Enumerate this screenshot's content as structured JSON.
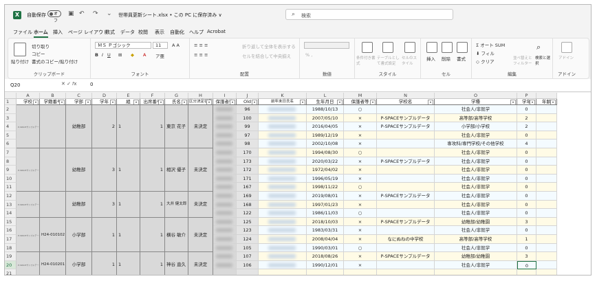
{
  "app": {
    "logo": "excel-logo",
    "autosave_label": "自動保存",
    "autosave_state": "オフ",
    "filename": "世帯員更新シート.xlsx • この PC に保存済み ∨",
    "search_placeholder": "検索"
  },
  "menu": {
    "tabs": [
      "ファイル",
      "ホーム",
      "挿入",
      "ページ レイアウト",
      "数式",
      "データ",
      "校閲",
      "表示",
      "自動化",
      "ヘルプ",
      "Acrobat"
    ],
    "active": "ホーム"
  },
  "ribbon": {
    "paste": "貼り付け",
    "cut": "切り取り",
    "copy": "コピー",
    "format_painter": "書式のコピー/貼り付け",
    "clipboard": "クリップボード",
    "font_name": "ＭＳ Ｐゴシック",
    "font_size": "11",
    "font_group": "フォント",
    "wrap_text": "折り返して全体を表示する",
    "merge_center": "セルを結合して中央揃え",
    "alignment_group": "配置",
    "number_group": "数値",
    "conditional_format": "条件付き書式",
    "format_as_table": "テーブルとして書式設定",
    "cell_styles": "セルのスタイル",
    "styles_group": "スタイル",
    "insert": "挿入",
    "delete": "削除",
    "format": "書式",
    "cells_group": "セル",
    "autosum": "オート SUM",
    "fill": "フィル",
    "clear": "クリア",
    "sort_filter": "並べ替えとフィルター",
    "find_select": "検索と選択",
    "editing_group": "編集",
    "addins": "アドイン",
    "addins_group": "アドイン"
  },
  "formula_bar": {
    "cell_ref": "Q20",
    "value": "0"
  },
  "columns": [
    "A",
    "B",
    "C",
    "D",
    "E",
    "F",
    "G",
    "H",
    "I",
    "J",
    "K",
    "L",
    "M",
    "N",
    "O",
    "P"
  ],
  "headers": [
    "学校",
    "学籍番号",
    "学部",
    "学年",
    "組",
    "出席番号",
    "氏名",
    "区分決定状況",
    "保護者等",
    "Old",
    "前年末日氏名",
    "生年月日",
    "保護者等",
    "学校名",
    "学種",
    "学年",
    "年齢"
  ],
  "rows": [
    {
      "n": "2",
      "old": "96",
      "birth": "1988/10/13",
      "m": "○",
      "school": "",
      "type": "社会人/非就学",
      "p": "0"
    },
    {
      "n": "3",
      "old": "100",
      "birth": "2007/05/10",
      "m": "×",
      "school": "P-SPACEサンプルデータ",
      "type": "高等部/高等学校",
      "p": "2"
    },
    {
      "n": "4",
      "old": "99",
      "birth": "2016/04/05",
      "m": "×",
      "school": "P-SPACEサンプルデータ",
      "type": "小学部/小学校",
      "p": "2"
    },
    {
      "n": "5",
      "old": "97",
      "birth": "1989/12/19",
      "m": "×",
      "school": "",
      "type": "社会人/非就学",
      "p": "0"
    },
    {
      "n": "6",
      "old": "98",
      "birth": "2002/10/08",
      "m": "×",
      "school": "",
      "type": "専攻科/専門学校/その他学校",
      "p": "4"
    },
    {
      "n": "7",
      "old": "170",
      "birth": "1994/08/30",
      "m": "○",
      "school": "",
      "type": "社会人/非就学",
      "p": "0"
    },
    {
      "n": "8",
      "old": "173",
      "birth": "2020/03/22",
      "m": "×",
      "school": "P-SPACEサンプルデータ",
      "type": "社会人/非就学",
      "p": "0"
    },
    {
      "n": "9",
      "old": "172",
      "birth": "1972/04/02",
      "m": "×",
      "school": "",
      "type": "社会人/非就学",
      "p": "0"
    },
    {
      "n": "10",
      "old": "171",
      "birth": "1996/05/19",
      "m": "×",
      "school": "",
      "type": "社会人/非就学",
      "p": "0"
    },
    {
      "n": "11",
      "old": "167",
      "birth": "1998/11/22",
      "m": "○",
      "school": "",
      "type": "社会人/非就学",
      "p": "0"
    },
    {
      "n": "12",
      "old": "169",
      "birth": "2019/08/01",
      "m": "×",
      "school": "P-SPACEサンプルデータ",
      "type": "社会人/非就学",
      "p": "0"
    },
    {
      "n": "13",
      "old": "168",
      "birth": "1997/01/23",
      "m": "×",
      "school": "",
      "type": "社会人/非就学",
      "p": "0"
    },
    {
      "n": "14",
      "old": "122",
      "birth": "1986/11/03",
      "m": "○",
      "school": "",
      "type": "社会人/非就学",
      "p": "0"
    },
    {
      "n": "15",
      "old": "125",
      "birth": "2018/10/03",
      "m": "×",
      "school": "P-SPACEサンプルデータ",
      "type": "幼稚部/幼稚園",
      "p": "3"
    },
    {
      "n": "16",
      "old": "123",
      "birth": "1983/03/31",
      "m": "×",
      "school": "",
      "type": "社会人/非就学",
      "p": "0"
    },
    {
      "n": "17",
      "old": "124",
      "birth": "2008/04/04",
      "m": "×",
      "school": "なにぬねの中学校",
      "type": "高等部/高等学校",
      "p": "1"
    },
    {
      "n": "18",
      "old": "105",
      "birth": "1990/03/01",
      "m": "○",
      "school": "",
      "type": "社会人/非就学",
      "p": "0"
    },
    {
      "n": "19",
      "old": "107",
      "birth": "2018/08/26",
      "m": "×",
      "school": "P-SPACEサンプルデータ",
      "type": "幼稚部/幼稚園",
      "p": "3"
    },
    {
      "n": "20",
      "old": "106",
      "birth": "1990/12/01",
      "m": "×",
      "school": "",
      "type": "社会人/非就学",
      "p": "0"
    },
    {
      "n": "21",
      "old": "",
      "birth": "",
      "m": "",
      "school": "",
      "type": "",
      "p": ""
    }
  ],
  "groups": [
    {
      "start": 0,
      "len": 5,
      "dept": "幼稚部",
      "grade": "2",
      "cls": "1",
      "name": "東京 花子",
      "status": "未決定",
      "sid": ""
    },
    {
      "start": 5,
      "len": 5,
      "dept": "幼稚部",
      "grade": "3",
      "cls": "1",
      "name": "相沢 優子",
      "status": "未決定",
      "sid": ""
    },
    {
      "start": 10,
      "len": 3,
      "dept": "幼稚部",
      "grade": "3",
      "cls": "1",
      "name": "大井 健太郎",
      "status": "未決定",
      "sid": ""
    },
    {
      "start": 13,
      "len": 4,
      "dept": "小学部",
      "grade": "1",
      "cls": "1",
      "name": "横谷 敏介",
      "status": "未決定",
      "sid": "H24-010102"
    },
    {
      "start": 17,
      "len": 3,
      "dept": "小学部",
      "grade": "1",
      "cls": "1",
      "name": "神谷 直久",
      "status": "未決定",
      "sid": "H24-010201"
    }
  ]
}
